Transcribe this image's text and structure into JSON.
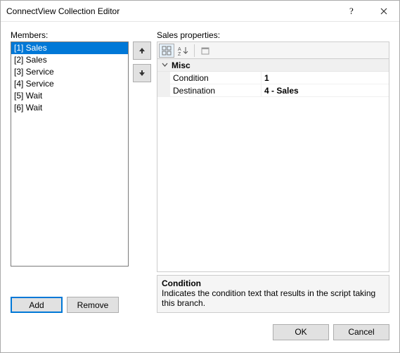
{
  "window": {
    "title": "ConnectView Collection Editor"
  },
  "left": {
    "label": "Members:",
    "items": [
      "[1] Sales",
      "[2] Sales",
      "[3] Service",
      "[4] Service",
      "[5] Wait",
      "[6] Wait"
    ],
    "selectedIndex": 0,
    "addLabel": "Add",
    "removeLabel": "Remove"
  },
  "right": {
    "label": "Sales properties:",
    "category": "Misc",
    "rows": [
      {
        "name": "Condition",
        "value": "1"
      },
      {
        "name": "Destination",
        "value": "4 - Sales"
      }
    ],
    "desc": {
      "title": "Condition",
      "text": "Indicates the condition text that results in the script taking this branch."
    }
  },
  "footer": {
    "ok": "OK",
    "cancel": "Cancel"
  }
}
